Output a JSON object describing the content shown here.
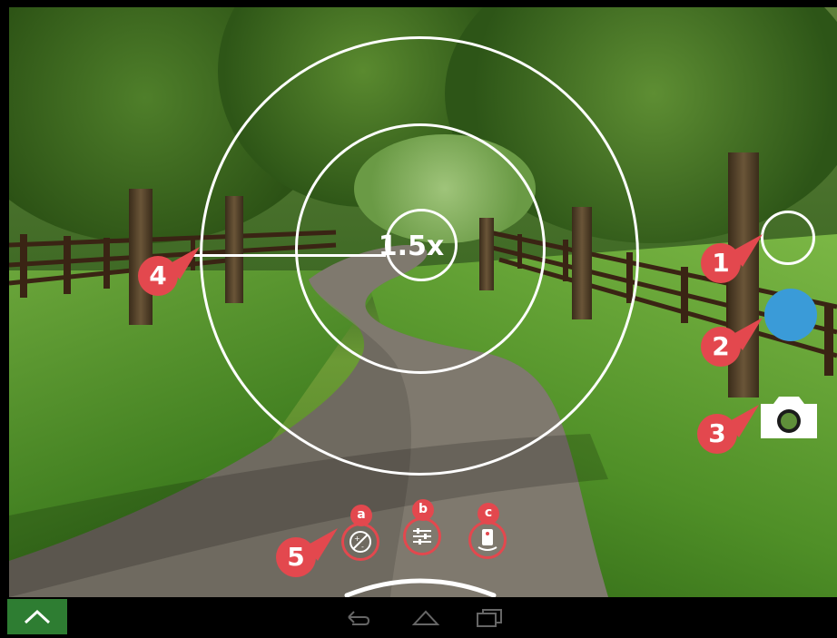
{
  "camera": {
    "zoom_label": "1.5x",
    "accent_color": "#3a9bd8",
    "callout_color": "#e3484e",
    "nav_expand_color": "#2e7d32"
  },
  "callouts": {
    "c1": "1",
    "c2": "2",
    "c3": "3",
    "c4": "4",
    "c5": "5"
  },
  "tools": [
    {
      "badge": "a",
      "icon": "exposure-icon"
    },
    {
      "badge": "b",
      "icon": "settings-sliders-icon"
    },
    {
      "badge": "c",
      "icon": "timer-icon"
    }
  ],
  "navigation": {
    "expand_icon": "chevron-up-icon",
    "back_icon": "back-icon",
    "home_icon": "home-icon",
    "recents_icon": "recents-icon"
  }
}
